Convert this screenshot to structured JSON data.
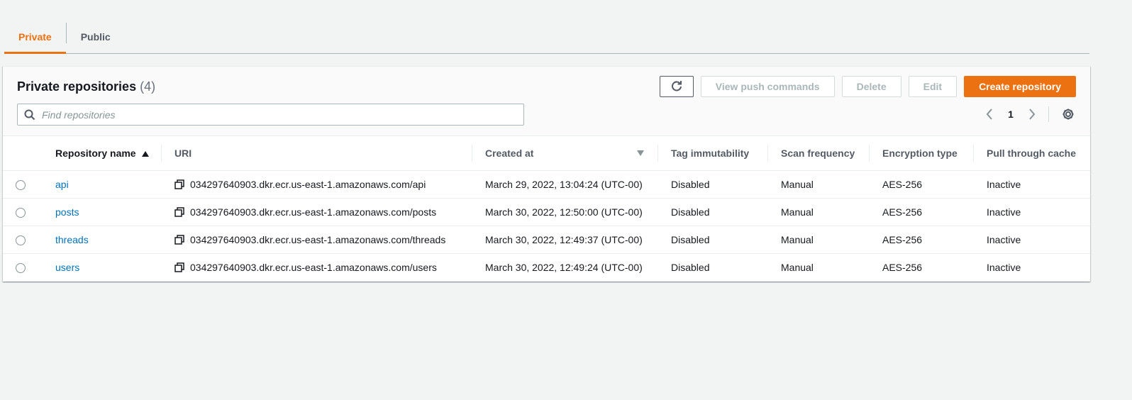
{
  "tabs": [
    {
      "label": "Private",
      "active": true
    },
    {
      "label": "Public",
      "active": false
    }
  ],
  "panel": {
    "title": "Private repositories",
    "count": "(4)"
  },
  "actions": {
    "refresh_icon": "refresh-icon",
    "view_push_commands": "View push commands",
    "delete": "Delete",
    "edit": "Edit",
    "create_repository": "Create repository"
  },
  "search": {
    "placeholder": "Find repositories",
    "value": ""
  },
  "pagination": {
    "current_page": "1",
    "prev_icon": "chevron-left-icon",
    "next_icon": "chevron-right-icon",
    "settings_icon": "gear-icon"
  },
  "table": {
    "columns": [
      "Repository name",
      "URI",
      "Created at",
      "Tag immutability",
      "Scan frequency",
      "Encryption type",
      "Pull through cache"
    ],
    "rows": [
      {
        "name": "api",
        "uri": "034297640903.dkr.ecr.us-east-1.amazonaws.com/api",
        "created": "March 29, 2022, 13:04:24 (UTC-00)",
        "tag_immutability": "Disabled",
        "scan_frequency": "Manual",
        "encryption": "AES-256",
        "pull_through_cache": "Inactive"
      },
      {
        "name": "posts",
        "uri": "034297640903.dkr.ecr.us-east-1.amazonaws.com/posts",
        "created": "March 30, 2022, 12:50:00 (UTC-00)",
        "tag_immutability": "Disabled",
        "scan_frequency": "Manual",
        "encryption": "AES-256",
        "pull_through_cache": "Inactive"
      },
      {
        "name": "threads",
        "uri": "034297640903.dkr.ecr.us-east-1.amazonaws.com/threads",
        "created": "March 30, 2022, 12:49:37 (UTC-00)",
        "tag_immutability": "Disabled",
        "scan_frequency": "Manual",
        "encryption": "AES-256",
        "pull_through_cache": "Inactive"
      },
      {
        "name": "users",
        "uri": "034297640903.dkr.ecr.us-east-1.amazonaws.com/users",
        "created": "March 30, 2022, 12:49:24 (UTC-00)",
        "tag_immutability": "Disabled",
        "scan_frequency": "Manual",
        "encryption": "AES-256",
        "pull_through_cache": "Inactive"
      }
    ]
  },
  "colors": {
    "accent": "#ec7211",
    "link": "#0073bb",
    "disabled_text": "#aab7b8"
  }
}
